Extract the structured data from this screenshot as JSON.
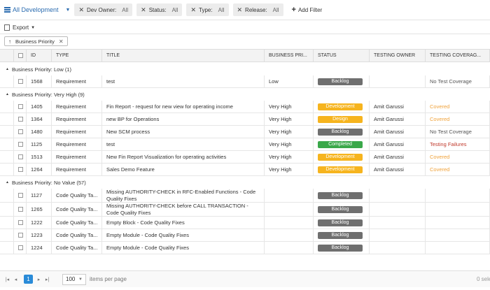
{
  "filterbar": {
    "view_label": "All Development",
    "filters": [
      {
        "name": "Dev Owner:",
        "value": "All"
      },
      {
        "name": "Status:",
        "value": "All"
      },
      {
        "name": "Type:",
        "value": "All"
      },
      {
        "name": "Release:",
        "value": "All"
      }
    ],
    "add_filter_label": "Add Filter"
  },
  "toolbar": {
    "export_label": "Export"
  },
  "grouping": {
    "chip_label": "Business Priority"
  },
  "grid": {
    "columns": [
      "ID",
      "TYPE",
      "TITLE",
      "BUSINESS PRI...",
      "STATUS",
      "TESTING OWNER",
      "TESTING COVERAG..."
    ],
    "groups": [
      {
        "label": "Business Priority: Low (1)",
        "rows": [
          {
            "id": "1568",
            "type": "Requirement",
            "title": "test",
            "priority": "Low",
            "status": "Backlog",
            "owner": "",
            "coverage": "No Test Coverage"
          }
        ]
      },
      {
        "label": "Business Priority: Very High (9)",
        "rows": [
          {
            "id": "1405",
            "type": "Requirement",
            "title": "Fin Report - request for new view for operating income",
            "priority": "Very High",
            "status": "Development",
            "owner": "Amit Garussi",
            "coverage": "Covered"
          },
          {
            "id": "1364",
            "type": "Requirement",
            "title": "new BP for Operations",
            "priority": "Very High",
            "status": "Design",
            "owner": "Amit Garussi",
            "coverage": "Covered"
          },
          {
            "id": "1480",
            "type": "Requirement",
            "title": "New SCM process",
            "priority": "Very High",
            "status": "Backlog",
            "owner": "Amit Garussi",
            "coverage": "No Test Coverage"
          },
          {
            "id": "1125",
            "type": "Requirement",
            "title": "test",
            "priority": "Very High",
            "status": "Completed",
            "owner": "Amit Garussi",
            "coverage": "Testing Failures"
          },
          {
            "id": "1513",
            "type": "Requirement",
            "title": "New Fin Report Visualization for operating activities",
            "priority": "Very High",
            "status": "Development",
            "owner": "Amit Garussi",
            "coverage": "Covered"
          },
          {
            "id": "1264",
            "type": "Requirement",
            "title": "Sales Demo Feature",
            "priority": "Very High",
            "status": "Development",
            "owner": "Amit Garussi",
            "coverage": "Covered"
          }
        ]
      },
      {
        "label": "Business Priority: No Value (57)",
        "rows": [
          {
            "id": "1127",
            "type": "Code Quality Ta...",
            "title": "Missing AUTHORITY-CHECK in RFC-Enabled Functions - Code Quality Fixes",
            "priority": "",
            "status": "Backlog",
            "owner": "",
            "coverage": ""
          },
          {
            "id": "1265",
            "type": "Code Quality Ta...",
            "title": "Missing AUTHORITY-CHECK before CALL TRANSACTION - Code Quality Fixes",
            "priority": "",
            "status": "Backlog",
            "owner": "",
            "coverage": ""
          },
          {
            "id": "1222",
            "type": "Code Quality Ta...",
            "title": "Empty Block - Code Quality Fixes",
            "priority": "",
            "status": "Backlog",
            "owner": "",
            "coverage": ""
          },
          {
            "id": "1223",
            "type": "Code Quality Ta...",
            "title": "Empty Module - Code Quality Fixes",
            "priority": "",
            "status": "Backlog",
            "owner": "",
            "coverage": ""
          },
          {
            "id": "1224",
            "type": "Code Quality Ta...",
            "title": "Empty Module - Code Quality Fixes",
            "priority": "",
            "status": "Backlog",
            "owner": "",
            "coverage": ""
          }
        ]
      }
    ]
  },
  "pager": {
    "current_page": "1",
    "page_size": "100",
    "items_per_page_label": "items per page",
    "selection_text": "0 sele"
  },
  "colors": {
    "Backlog": "#6f6f6f",
    "Development": "#f6b41e",
    "Design": "#f6b41e",
    "Completed": "#3aa84a",
    "Covered": "#f0a23a",
    "Testing Failures": "#c0392b",
    "No Test Coverage": "#555555",
    "accent": "#2b6cb0"
  }
}
